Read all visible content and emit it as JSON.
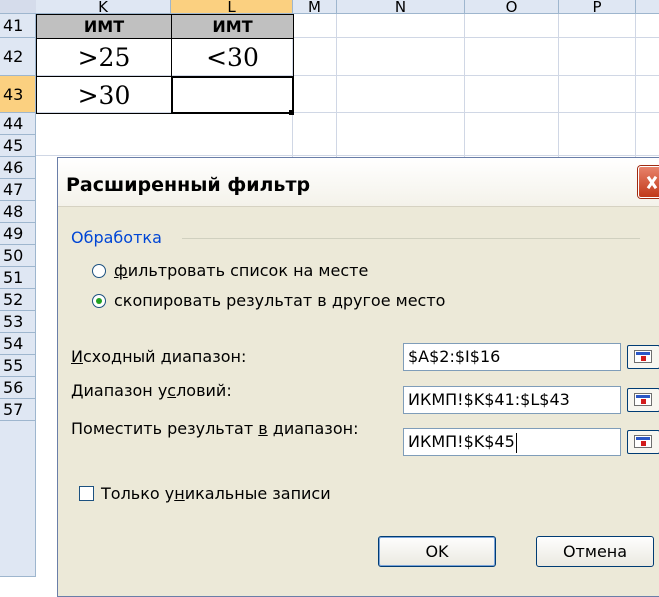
{
  "sheet": {
    "columns": [
      "K",
      "L",
      "M",
      "N",
      "O",
      "P"
    ],
    "rows": [
      "41",
      "42",
      "43",
      "44",
      "45",
      "46",
      "47",
      "48",
      "49",
      "50",
      "51",
      "52",
      "53",
      "54",
      "55",
      "56",
      "57"
    ],
    "cells": {
      "K41": "ИМТ",
      "L41": "ИМТ",
      "K42": ">25",
      "L42": "<30",
      "K43": ">30",
      "L43": ""
    }
  },
  "dialog": {
    "title": "Расширенный фильтр",
    "group_label": "Обработка",
    "option_filter_in_place": {
      "underlined": "ф",
      "rest": "ильтровать список на месте",
      "checked": false
    },
    "option_copy": {
      "underlined": "",
      "prefix": "скопировать результат в ",
      "underlined2": "д",
      "rest": "ругое место",
      "checked": true
    },
    "source_range_label": {
      "underlined": "И",
      "rest": "сходный диапазон:"
    },
    "source_range_value": "$A$2:$I$16",
    "criteria_range_label": {
      "prefix": "Диапазон у",
      "underlined": "с",
      "rest": "ловий:"
    },
    "criteria_range_value": "ИКМП!$K$41:$L$43",
    "output_range_label": {
      "prefix": "Поместить результат ",
      "underlined": "в",
      "rest": " диапазон:"
    },
    "output_range_value": "ИКМП!$K$45",
    "unique_label": {
      "prefix": "Только у",
      "underlined": "н",
      "rest": "икальные записи"
    },
    "unique_checked": false,
    "ok_label": "OK",
    "cancel_label": "Отмена"
  },
  "icons": {
    "close": "close-icon",
    "range_picker": "range-picker-icon"
  },
  "colors": {
    "selected_header": "#fbd080",
    "header": "#dfe7f3",
    "dialog_bg": "#ece9d8",
    "group_label": "#0046d5",
    "close_button": "#c1391a"
  }
}
